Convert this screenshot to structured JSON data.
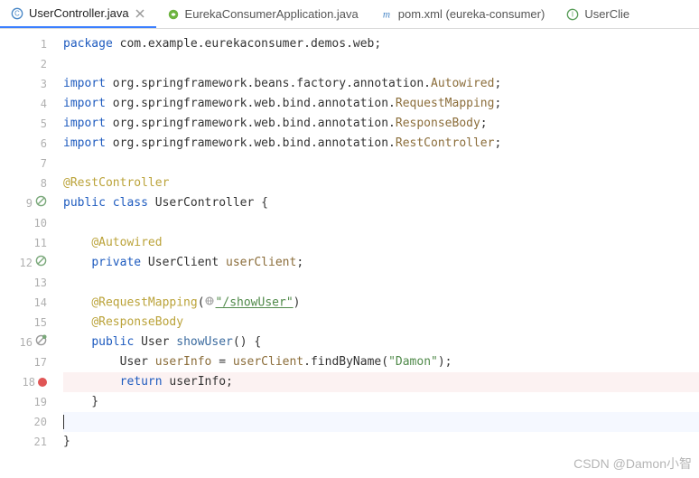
{
  "tabs": [
    {
      "label": "UserController.java",
      "icon": "class-icon",
      "active": true,
      "closable": true
    },
    {
      "label": "EurekaConsumerApplication.java",
      "icon": "spring-icon",
      "active": false,
      "closable": false
    },
    {
      "label": "pom.xml (eureka-consumer)",
      "icon": "maven-icon",
      "active": false,
      "closable": false
    },
    {
      "label": "UserClie",
      "icon": "interface-icon",
      "active": false,
      "closable": false
    }
  ],
  "gutterIcons": {
    "9": "suppress",
    "12": "suppress",
    "16": "mixed",
    "18": "breakpoint"
  },
  "totalLines": 21,
  "highlightLines": [
    18
  ],
  "currentLine": 20,
  "code": {
    "1": [
      [
        "kw",
        "package"
      ],
      [
        "pkg",
        " com.example.eurekaconsumer.demos.web;"
      ]
    ],
    "2": [],
    "3": [
      [
        "kw",
        "import"
      ],
      [
        "pkg",
        " org.springframework.beans.factory.annotation."
      ],
      [
        "id",
        "Autowired"
      ],
      [
        "",
        ";"
      ]
    ],
    "4": [
      [
        "kw",
        "import"
      ],
      [
        "pkg",
        " org.springframework.web.bind.annotation."
      ],
      [
        "id",
        "RequestMapping"
      ],
      [
        "",
        ";"
      ]
    ],
    "5": [
      [
        "kw",
        "import"
      ],
      [
        "pkg",
        " org.springframework.web.bind.annotation."
      ],
      [
        "id",
        "ResponseBody"
      ],
      [
        "",
        ";"
      ]
    ],
    "6": [
      [
        "kw",
        "import"
      ],
      [
        "pkg",
        " org.springframework.web.bind.annotation."
      ],
      [
        "id",
        "RestController"
      ],
      [
        "",
        ";"
      ]
    ],
    "7": [],
    "8": [
      [
        "ann",
        "@RestController"
      ]
    ],
    "9": [
      [
        "kw",
        "public class"
      ],
      [
        "",
        " UserController {"
      ]
    ],
    "10": [],
    "11": [
      [
        "",
        "    "
      ],
      [
        "ann",
        "@Autowired"
      ]
    ],
    "12": [
      [
        "",
        "    "
      ],
      [
        "kw",
        "private"
      ],
      [
        "",
        " UserClient "
      ],
      [
        "id",
        "userClient"
      ],
      [
        "",
        ";"
      ]
    ],
    "13": [],
    "14": [
      [
        "",
        "    "
      ],
      [
        "ann",
        "@RequestMapping"
      ],
      [
        "",
        "("
      ],
      [
        "globe",
        ""
      ],
      [
        "",
        ""
      ],
      [
        "str",
        "\"/showUser\""
      ],
      [
        "",
        ")"
      ]
    ],
    "15": [
      [
        "",
        "    "
      ],
      [
        "ann",
        "@ResponseBody"
      ]
    ],
    "16": [
      [
        "",
        "    "
      ],
      [
        "kw",
        "public"
      ],
      [
        "",
        " User "
      ],
      [
        "fn",
        "showUser"
      ],
      [
        "",
        "() {"
      ]
    ],
    "17": [
      [
        "",
        "        User "
      ],
      [
        "id",
        "userInfo"
      ],
      [
        "",
        " = "
      ],
      [
        "id",
        "userClient"
      ],
      [
        "",
        ".findByName("
      ],
      [
        "str",
        "\"Damon\""
      ],
      [
        "",
        ");"
      ]
    ],
    "18": [
      [
        "",
        "        "
      ],
      [
        "kw",
        "return"
      ],
      [
        "",
        " userInfo;"
      ]
    ],
    "19": [
      [
        "",
        "    }"
      ]
    ],
    "20": [
      [
        "caret",
        ""
      ]
    ],
    "21": [
      [
        "",
        "}"
      ]
    ]
  },
  "watermark": "CSDN @Damon小智"
}
